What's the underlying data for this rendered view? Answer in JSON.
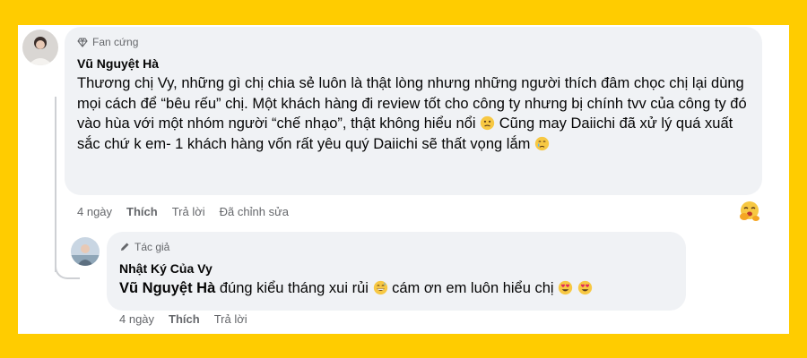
{
  "comment": {
    "badge": "Fan cứng",
    "author": "Vũ Nguyệt Hà",
    "text_part1": "Thương chị Vy, những gì chị chia sẻ luôn là thật lòng nhưng những người thích đâm chọc chị lại dùng mọi cách để “bêu rếu” chị. Một khách hàng đi review tốt cho công ty nhưng bị chính tvv của công ty đó vào hùa với một nhóm người “chế nhạo”, thật không hiểu nổi",
    "text_part2": " Cũng may Daiichi đã xử lý quá xuất sắc chứ k em- 1 khách hàng vốn rất yêu quý Daiichi sẽ thất vọng lắm",
    "time": "4 ngày",
    "like": "Thích",
    "reply": "Trả lời",
    "edited": "Đã chỉnh sửa",
    "reaction_icon": "face-hand-over-mouth-emoji"
  },
  "reply": {
    "badge": "Tác giả",
    "author": "Nhật Ký Của Vy",
    "mention": "Vũ Nguyệt Hà",
    "text_part1": " đúng kiểu tháng xui rủi",
    "text_part2": " cám ơn em luôn hiểu chị",
    "time": "4 ngày",
    "like": "Thích",
    "reply": "Trả lời"
  }
}
